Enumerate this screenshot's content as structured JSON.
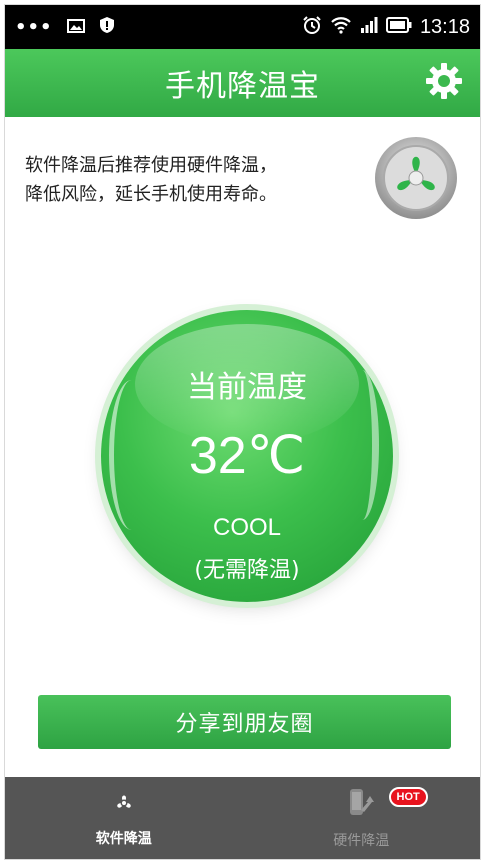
{
  "status_bar": {
    "dots": "•••",
    "time": "13:18",
    "icons": [
      "image-icon",
      "shield-icon",
      "alarm-icon",
      "wifi-icon",
      "signal-icon",
      "battery-icon"
    ]
  },
  "header": {
    "title": "手机降温宝",
    "settings_icon": "gear-icon"
  },
  "intro": {
    "line1": "软件降温后推荐使用硬件降温，",
    "line2": "降低风险，延长手机使用寿命。"
  },
  "temperature": {
    "label": "当前温度",
    "value": "32℃",
    "status": "COOL",
    "note": "(无需降温)"
  },
  "share_button": "分享到朋友圈",
  "tabs": [
    {
      "label": "软件降温",
      "icon": "fan-icon",
      "active": true
    },
    {
      "label": "硬件降温",
      "icon": "phone-cooler-icon",
      "active": false,
      "badge": "HOT"
    }
  ],
  "colors": {
    "primary_green": "#3cb94e",
    "tab_bar": "#555555",
    "hot_badge": "#e8131e"
  }
}
